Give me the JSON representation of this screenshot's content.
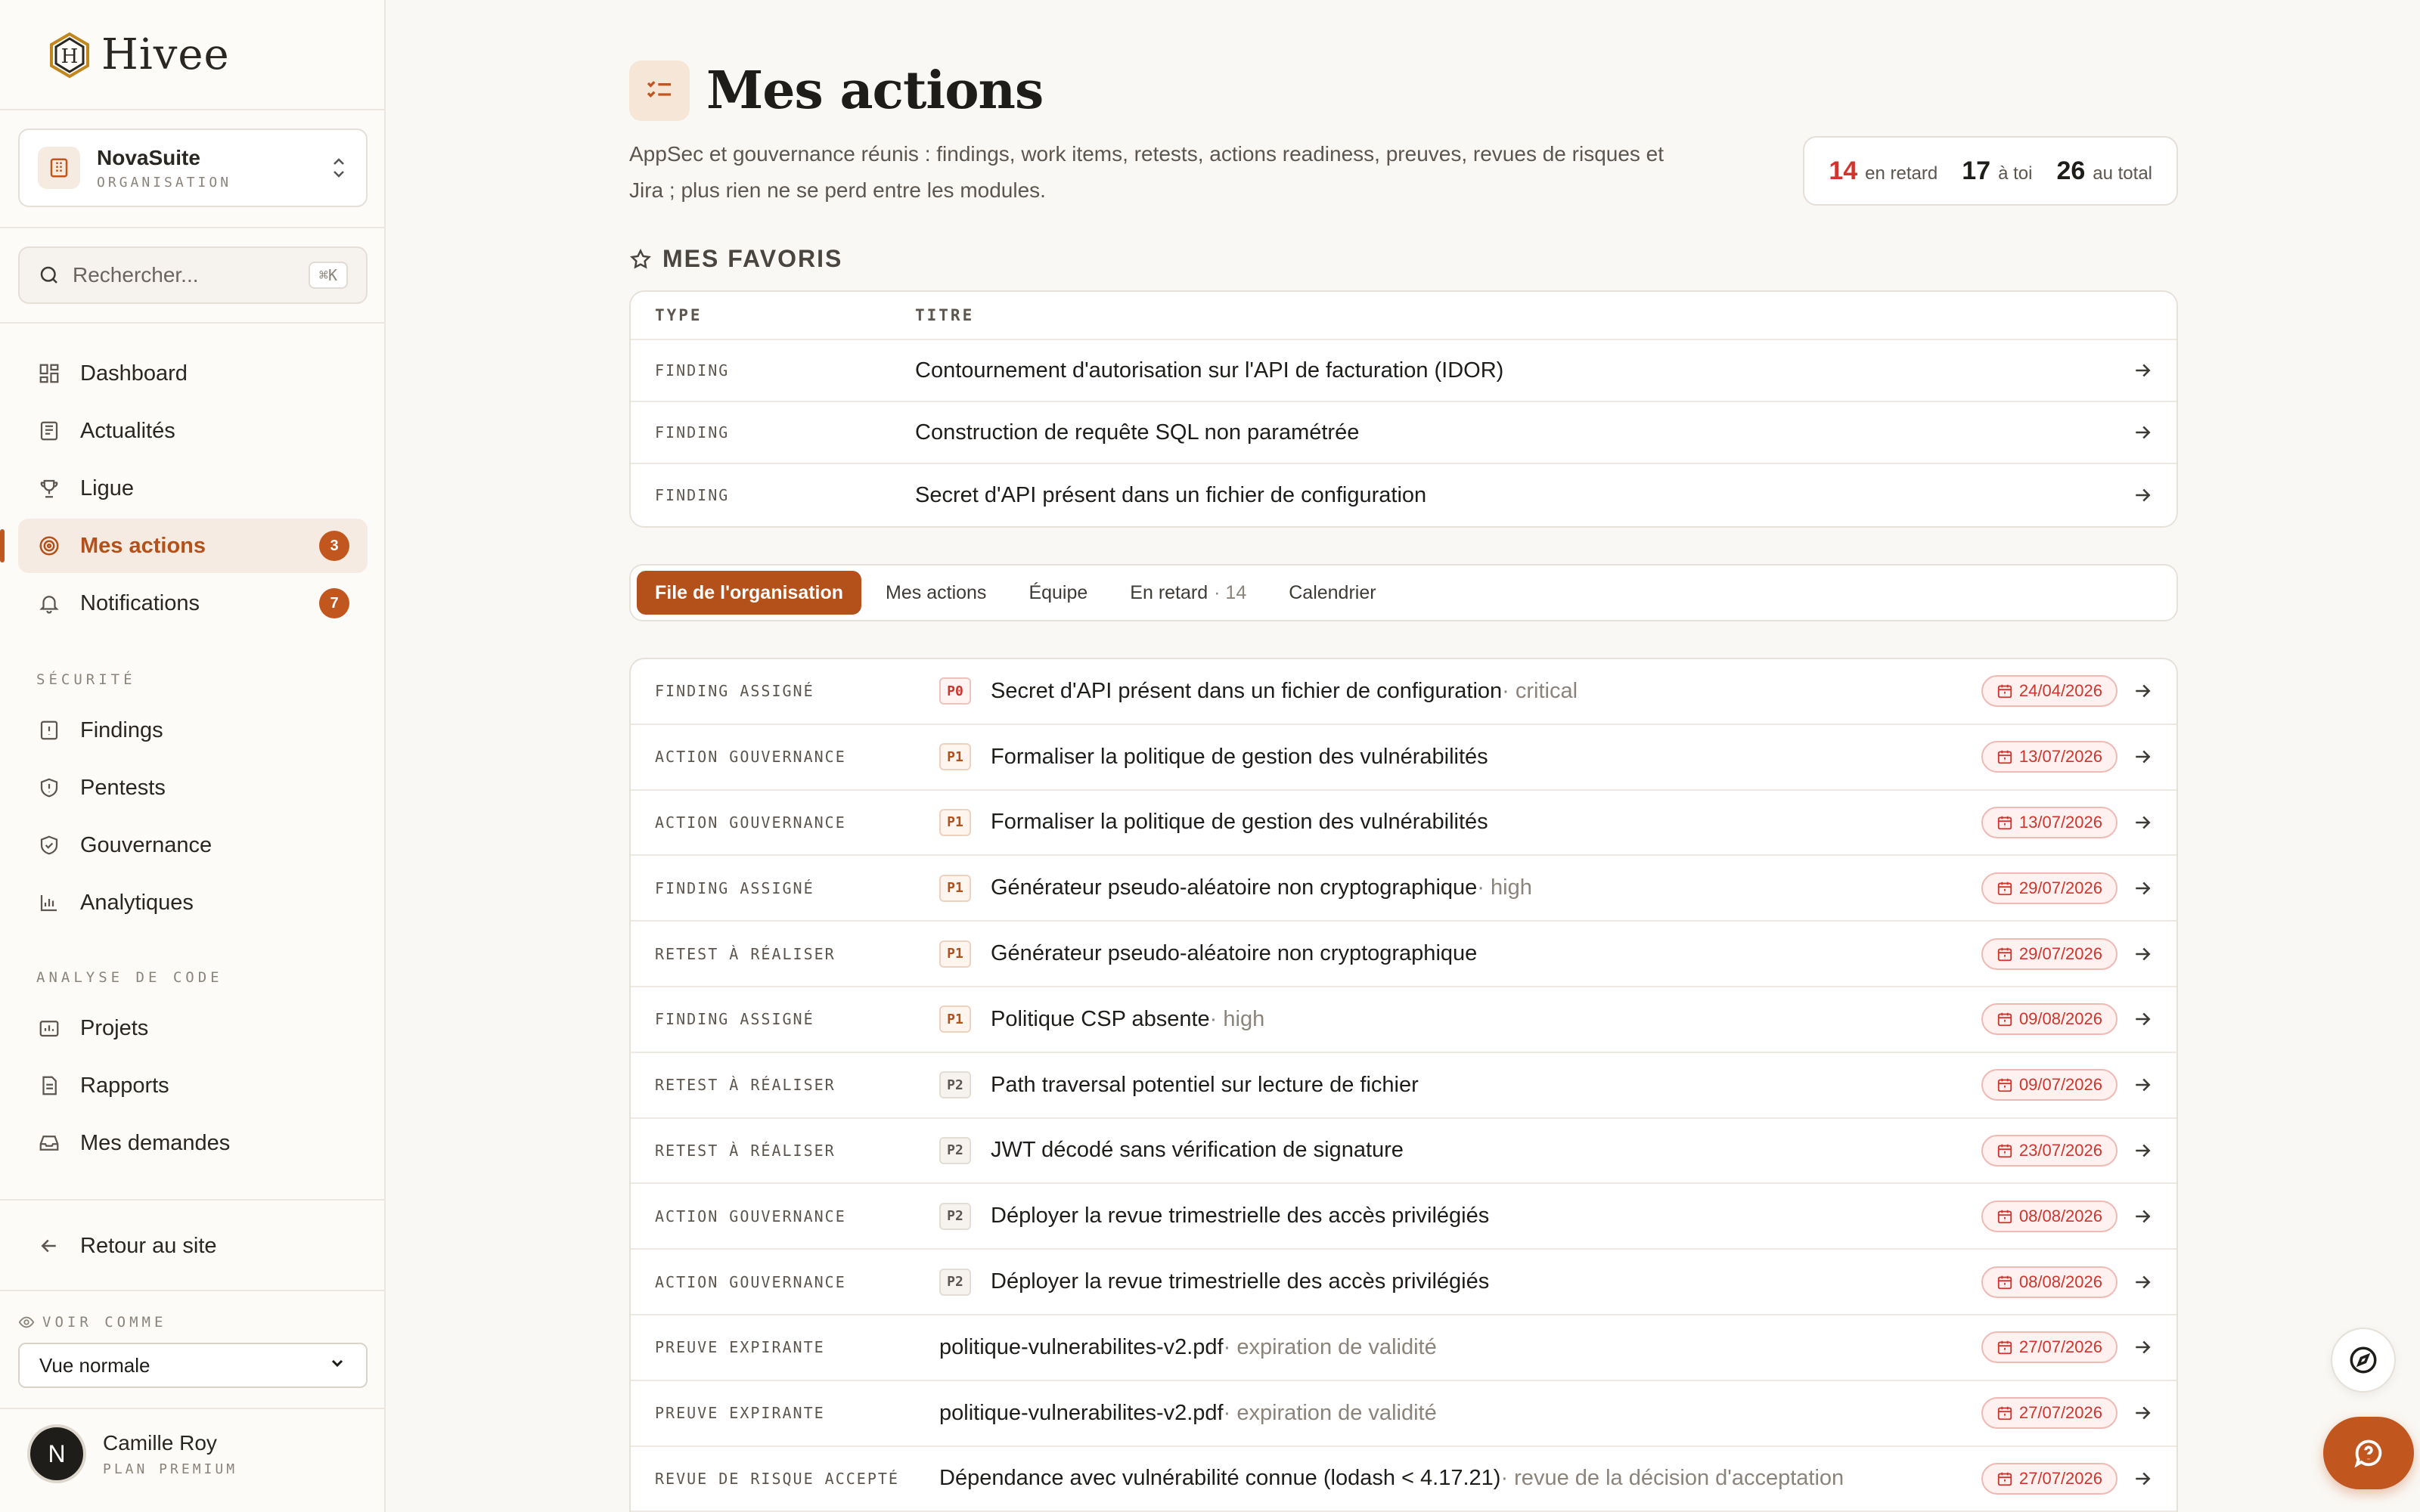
{
  "brand": {
    "name": "Hivee"
  },
  "org": {
    "name": "NovaSuite",
    "sub": "ORGANISATION"
  },
  "search": {
    "placeholder": "Rechercher...",
    "shortcut": "⌘K"
  },
  "nav_main": [
    {
      "label": "Dashboard"
    },
    {
      "label": "Actualités"
    },
    {
      "label": "Ligue"
    },
    {
      "label": "Mes actions",
      "badge": "3"
    },
    {
      "label": "Notifications",
      "badge": "7"
    }
  ],
  "section_security": "SÉCURITÉ",
  "nav_security": [
    {
      "label": "Findings"
    },
    {
      "label": "Pentests"
    },
    {
      "label": "Gouvernance"
    },
    {
      "label": "Analytiques"
    }
  ],
  "section_code": "ANALYSE DE CODE",
  "nav_code": [
    {
      "label": "Projets"
    },
    {
      "label": "Rapports"
    },
    {
      "label": "Mes demandes"
    }
  ],
  "back_link": "Retour au site",
  "view_as": {
    "label": "VOIR COMME",
    "value": "Vue normale"
  },
  "user": {
    "initial": "N",
    "name": "Camille Roy",
    "plan": "PLAN PREMIUM"
  },
  "page": {
    "title": "Mes actions",
    "description": "AppSec et gouvernance réunis : findings, work items, retests, actions readiness, preuves, revues de risques et Jira ; plus rien ne se perd entre les modules."
  },
  "stats": [
    {
      "value": "14",
      "label": "en retard"
    },
    {
      "value": "17",
      "label": "à toi"
    },
    {
      "value": "26",
      "label": "au total"
    }
  ],
  "favorites": {
    "title": "MES FAVORIS",
    "col_type": "TYPE",
    "col_title": "TITRE",
    "rows": [
      {
        "type": "FINDING",
        "title": "Contournement d'autorisation sur l'API de facturation (IDOR)"
      },
      {
        "type": "FINDING",
        "title": "Construction de requête SQL non paramétrée"
      },
      {
        "type": "FINDING",
        "title": "Secret d'API présent dans un fichier de configuration"
      }
    ]
  },
  "tabs": [
    {
      "label": "File de l'organisation"
    },
    {
      "label": "Mes actions"
    },
    {
      "label": "Équipe"
    },
    {
      "label": "En retard",
      "count": "· 14"
    },
    {
      "label": "Calendrier"
    }
  ],
  "actions": [
    {
      "type": "FINDING ASSIGNÉ",
      "priority": "P0",
      "title": "Secret d'API présent dans un fichier de configuration",
      "suffix": " · critical",
      "date": "24/04/2026"
    },
    {
      "type": "ACTION GOUVERNANCE",
      "priority": "P1",
      "title": "Formaliser la politique de gestion des vulnérabilités",
      "suffix": "",
      "date": "13/07/2026"
    },
    {
      "type": "ACTION GOUVERNANCE",
      "priority": "P1",
      "title": "Formaliser la politique de gestion des vulnérabilités",
      "suffix": "",
      "date": "13/07/2026"
    },
    {
      "type": "FINDING ASSIGNÉ",
      "priority": "P1",
      "title": "Générateur pseudo-aléatoire non cryptographique",
      "suffix": " · high",
      "date": "29/07/2026"
    },
    {
      "type": "RETEST À RÉALISER",
      "priority": "P1",
      "title": "Générateur pseudo-aléatoire non cryptographique",
      "suffix": "",
      "date": "29/07/2026"
    },
    {
      "type": "FINDING ASSIGNÉ",
      "priority": "P1",
      "title": "Politique CSP absente",
      "suffix": " · high",
      "date": "09/08/2026"
    },
    {
      "type": "RETEST À RÉALISER",
      "priority": "P2",
      "title": "Path traversal potentiel sur lecture de fichier",
      "suffix": "",
      "date": "09/07/2026"
    },
    {
      "type": "RETEST À RÉALISER",
      "priority": "P2",
      "title": "JWT décodé sans vérification de signature",
      "suffix": "",
      "date": "23/07/2026"
    },
    {
      "type": "ACTION GOUVERNANCE",
      "priority": "P2",
      "title": "Déployer la revue trimestrielle des accès privilégiés",
      "suffix": "",
      "date": "08/08/2026"
    },
    {
      "type": "ACTION GOUVERNANCE",
      "priority": "P2",
      "title": "Déployer la revue trimestrielle des accès privilégiés",
      "suffix": "",
      "date": "08/08/2026"
    },
    {
      "type": "PREUVE EXPIRANTE",
      "priority": "",
      "title": "politique-vulnerabilites-v2.pdf",
      "suffix": " · expiration de validité",
      "date": "27/07/2026"
    },
    {
      "type": "PREUVE EXPIRANTE",
      "priority": "",
      "title": "politique-vulnerabilites-v2.pdf",
      "suffix": " · expiration de validité",
      "date": "27/07/2026"
    },
    {
      "type": "REVUE DE RISQUE ACCEPTÉ",
      "priority": "",
      "title": "Dépendance avec vulnérabilité connue (lodash < 4.17.21)",
      "suffix": " · revue de la décision d'acceptation",
      "date": "27/07/2026"
    }
  ],
  "colors": {
    "accent": "#c2561f",
    "danger": "#d0342c",
    "background": "#faf8f4"
  }
}
